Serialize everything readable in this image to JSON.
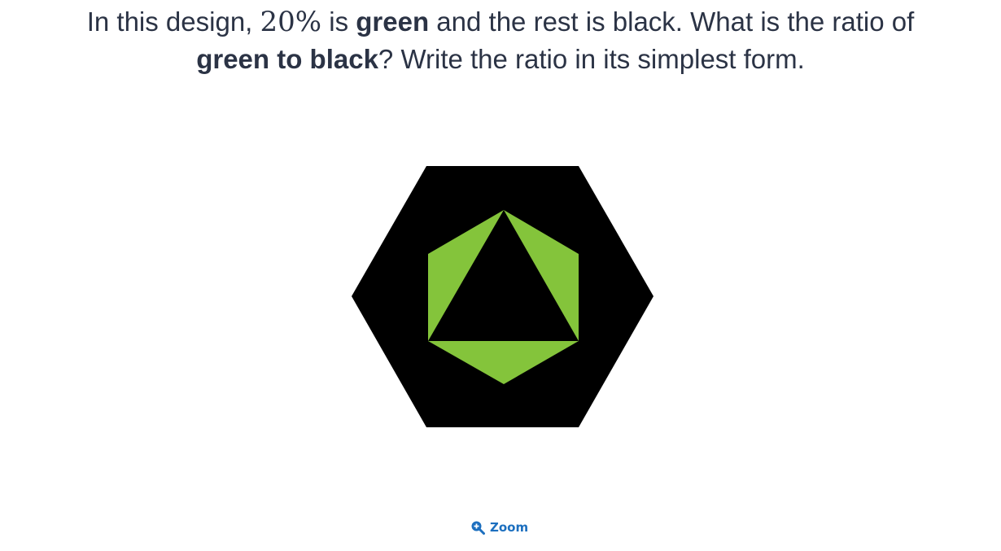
{
  "question": {
    "line1_prefix": "In this design, ",
    "percent": "20%",
    "line1_mid": " is ",
    "green_word": "green",
    "line1_suffix": " and the rest is black. What is the ratio of",
    "bold_phrase": "green to black",
    "line2_suffix": "? Write the ratio in its simplest form."
  },
  "figure": {
    "outer_hexagon_color": "#000000",
    "inner_hexagon_color": "#84c43b",
    "inner_triangle_color": "#000000"
  },
  "zoom": {
    "label": "Zoom",
    "icon": "zoom-in-icon",
    "color": "#1c6fbf"
  }
}
